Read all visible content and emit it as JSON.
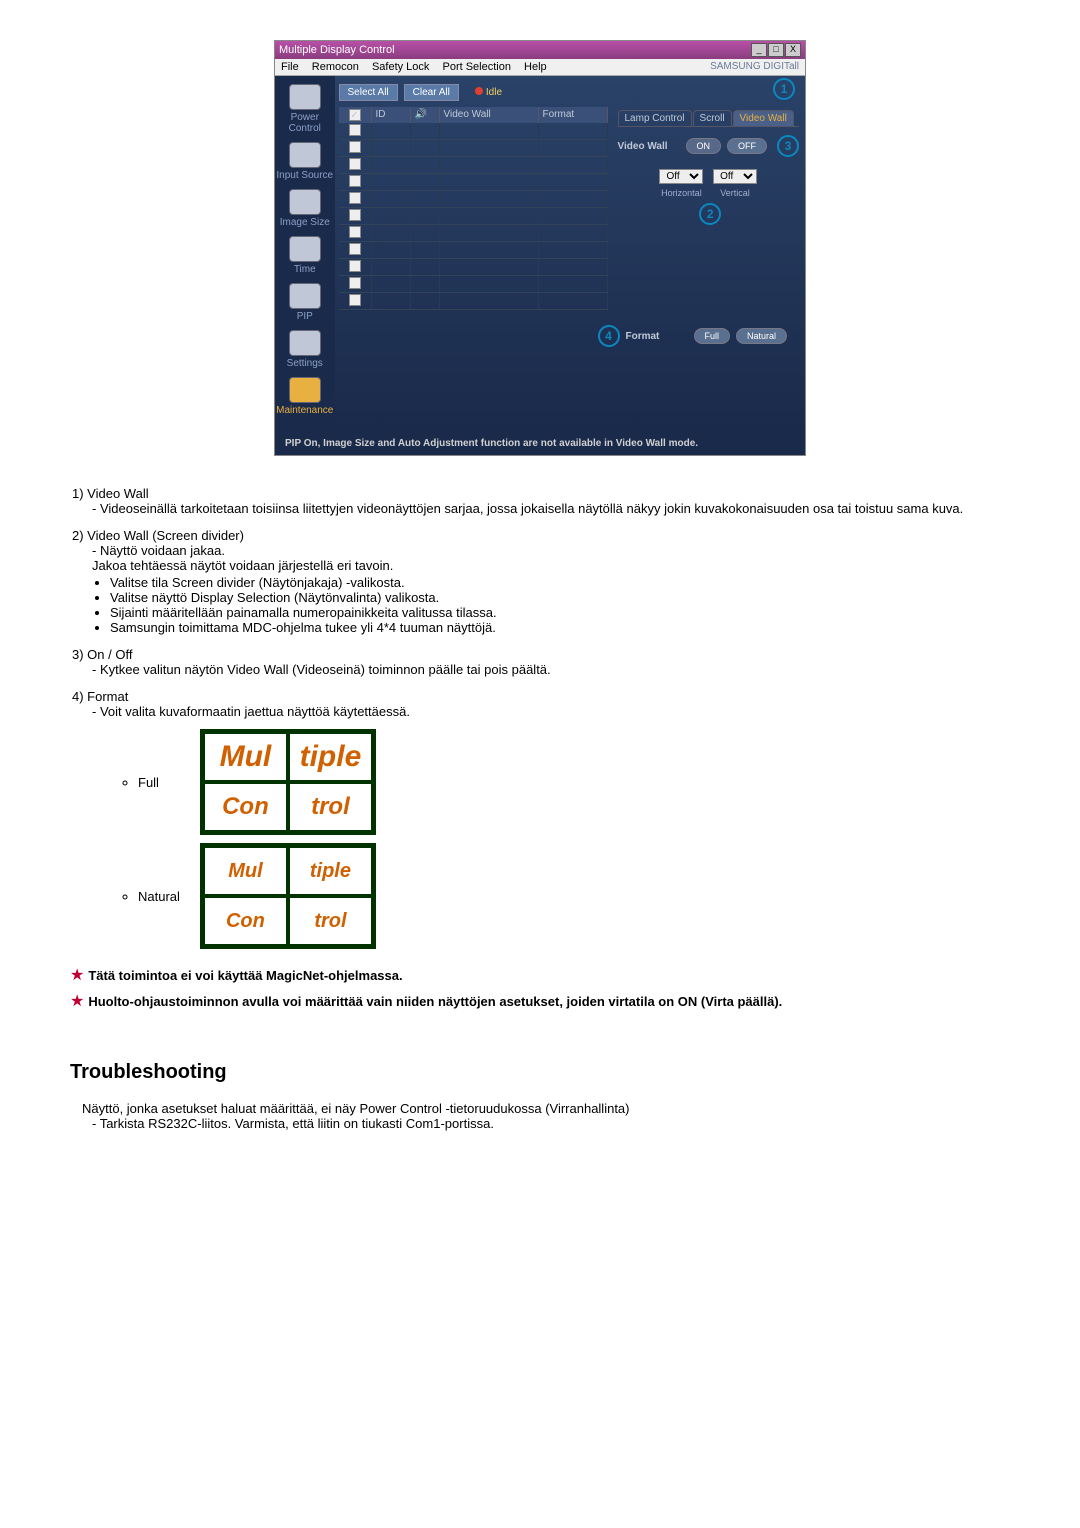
{
  "window": {
    "title": "Multiple Display Control"
  },
  "menu": {
    "file": "File",
    "remocon": "Remocon",
    "safetylock": "Safety Lock",
    "portselection": "Port Selection",
    "help": "Help",
    "brand": "SAMSUNG DIGITall"
  },
  "sidebar": {
    "power": "Power Control",
    "input": "Input Source",
    "imgsize": "Image Size",
    "time": "Time",
    "pip": "PIP",
    "settings": "Settings",
    "maintenance": "Maintenance"
  },
  "toolbar": {
    "selectall": "Select All",
    "clearall": "Clear All",
    "idle": "Idle"
  },
  "table": {
    "h_id": "ID",
    "h_vw": "Video Wall",
    "h_fmt": "Format"
  },
  "tabs": {
    "lamp": "Lamp Control",
    "scroll": "Scroll",
    "videowall": "Video Wall"
  },
  "vw": {
    "label": "Video Wall",
    "on": "ON",
    "off": "OFF",
    "h_val": "Off",
    "h_lbl": "Horizontal",
    "v_val": "Off",
    "v_lbl": "Vertical"
  },
  "fmt": {
    "label": "Format",
    "full": "Full",
    "natural": "Natural"
  },
  "markers": {
    "m1": "1",
    "m2": "2",
    "m3": "3",
    "m4": "4"
  },
  "status": "PIP On, Image Size and Auto Adjustment function are not available in Video Wall mode.",
  "body": {
    "i1_title": "1) Video Wall",
    "i1_desc": "- Videoseinällä tarkoitetaan toisiinsa liitettyjen videonäyttöjen sarjaa, jossa jokaisella näytöllä näkyy jokin kuvakokonaisuuden osa tai toistuu sama kuva.",
    "i2_title": "2) Video Wall (Screen divider)",
    "i2_a": "- Näyttö voidaan jakaa.",
    "i2_b": "Jakoa tehtäessä näytöt voidaan järjestellä eri tavoin.",
    "i2_b1": "Valitse tila Screen divider (Näytönjakaja) -valikosta.",
    "i2_b2": "Valitse näyttö Display Selection (Näytönvalinta) valikosta.",
    "i2_b3": "Sijainti määritellään painamalla numeropainikkeita valitussa tilassa.",
    "i2_b4": "Samsungin toimittama MDC-ohjelma tukee yli 4*4 tuuman näyttöjä.",
    "i3_title": "3) On / Off",
    "i3_desc": "- Kytkee valitun näytön Video Wall (Videoseinä) toiminnon päälle tai pois päältä.",
    "i4_title": "4) Format",
    "i4_desc": "- Voit valita kuvaformaatin jaettua näyttöä käytettäessä.",
    "fmt_full": "Full",
    "fmt_natural": "Natural",
    "logo_text": "Multiple Display Control",
    "note1": "Tätä toimintoa ei voi käyttää MagicNet-ohjelmassa.",
    "note2": "Huolto-ohjaustoiminnon avulla voi määrittää vain niiden näyttöjen asetukset, joiden virtatila on ON (Virta päällä)."
  },
  "ts": {
    "heading": "Troubleshooting",
    "i1": "Näyttö, jonka asetukset haluat määrittää, ei näy Power Control -tietoruudukossa (Virranhallinta)",
    "i1a": "- Tarkista RS232C-liitos. Varmista, että liitin on tiukasti Com1-portissa."
  }
}
